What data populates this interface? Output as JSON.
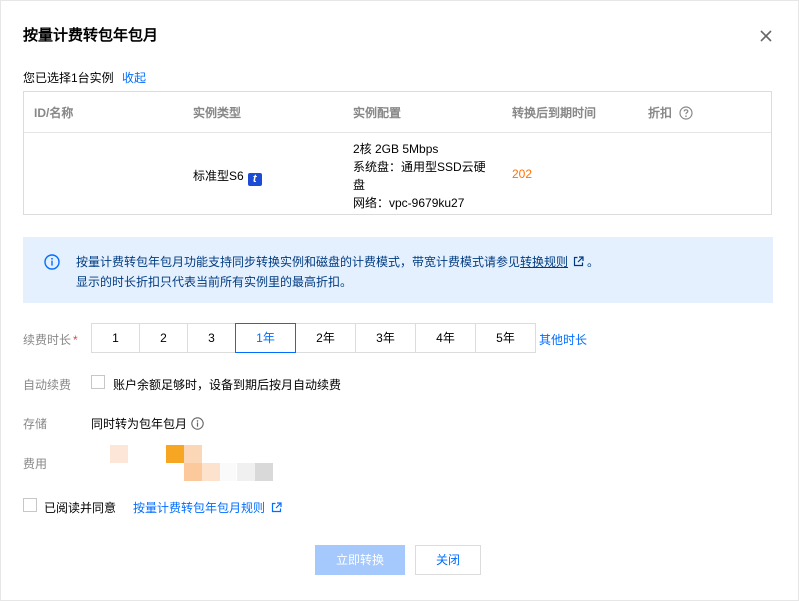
{
  "dialog": {
    "title": "按量计费转包年包月",
    "selected_text": "您已选择1台实例",
    "collapse_label": "收起"
  },
  "table": {
    "headers": {
      "id": "ID/名称",
      "type": "实例类型",
      "config": "实例配置",
      "expire": "转换后到期时间",
      "discount": "折扣"
    },
    "row": {
      "type": "标准型S6",
      "type_badge": "t",
      "config_line1": "2核 2GB 5Mbps",
      "config_line2": "系统盘：通用型SSD云硬",
      "config_line3": "盘",
      "config_line4": "网络：vpc-9679ku27",
      "expire": "202"
    }
  },
  "notice": {
    "line1_prefix": "按量计费转包年包月功能支持同步转换实例和磁盘的计费模式，带宽计费模式请参见",
    "line1_link": "转换规则",
    "line1_suffix": "。",
    "line2": "显示的时长折扣只代表当前所有实例里的最高折扣。"
  },
  "form": {
    "duration_label": "续费时长",
    "required_mark": "*",
    "durations": [
      "1",
      "2",
      "3",
      "1年",
      "2年",
      "3年",
      "4年",
      "5年"
    ],
    "selected_duration": "1年",
    "other_duration": "其他时长",
    "auto_renew_label": "自动续费",
    "auto_renew_text": "账户余额足够时，设备到期后按月自动续费",
    "storage_label": "存储",
    "storage_text": "同时转为包年包月",
    "fee_label": "费用"
  },
  "agreement": {
    "text": "已阅读并同意",
    "link": "按量计费转包年包月规则"
  },
  "footer": {
    "confirm": "立即转换",
    "close": "关闭"
  },
  "colors": {
    "primary": "#006eff",
    "primary_disabled": "#a5c9fc",
    "notice_bg": "#e5f0ff",
    "expire_orange": "#ff7200"
  }
}
